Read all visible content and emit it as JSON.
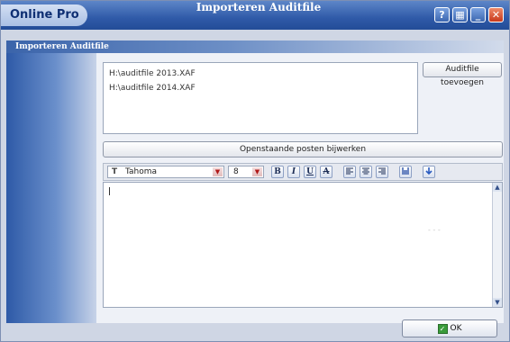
{
  "window": {
    "app_name": "Online Pro",
    "title": "Importeren Auditfile",
    "controls": [
      "help-icon",
      "options-icon",
      "minimize-icon",
      "close-icon"
    ]
  },
  "panel": {
    "title": "Importeren Auditfile"
  },
  "files": [
    "H:\\auditfile 2013.XAF",
    "H:\\auditfile 2014.XAF"
  ],
  "buttons": {
    "add": "Auditfile toevoegen",
    "update": "Openstaande posten bijwerken",
    "ok": "OK"
  },
  "toolbar": {
    "font": "Tahoma",
    "size": "8",
    "bold": "B",
    "italic": "I",
    "underline": "U",
    "strike": "A"
  },
  "editor": {
    "text": "",
    "faint_text": "-   -   -"
  },
  "colors": {
    "title_bar": "#2f5aa8",
    "close_button": "#c8391c",
    "ok_icon": "#3a9b3a"
  }
}
